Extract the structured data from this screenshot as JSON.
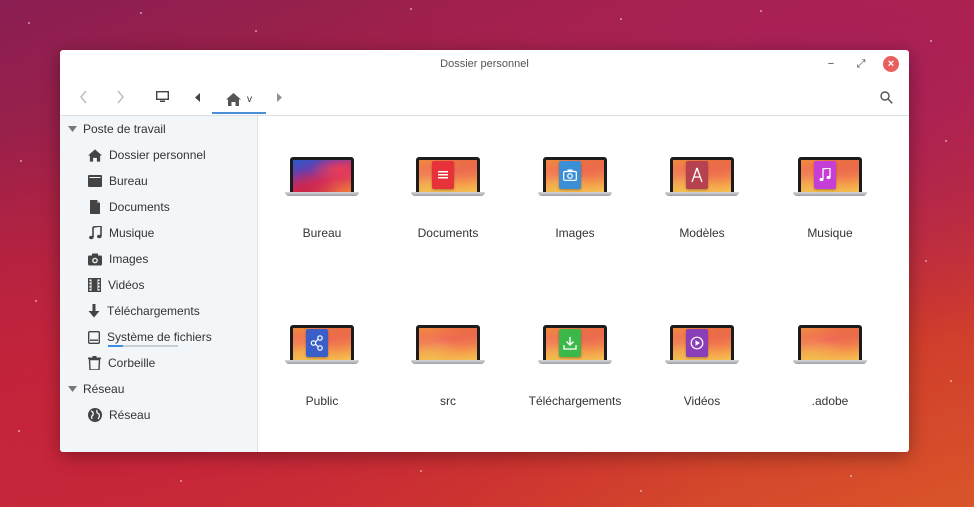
{
  "window": {
    "title": "Dossier personnel",
    "close_glyph": "×",
    "minimize_glyph": "−",
    "maximize_glyph": "⤢"
  },
  "toolbar": {
    "back_icon": "chevron-left-icon",
    "forward_icon": "chevron-right-icon",
    "computer_icon": "monitor-icon",
    "home_crumb_suffix": "v",
    "search_icon": "search-icon"
  },
  "sidebar": {
    "sections": [
      {
        "label": "Poste de travail"
      },
      {
        "label": "Réseau"
      }
    ],
    "items": [
      {
        "label": "Dossier personnel",
        "icon": "home-icon"
      },
      {
        "label": "Bureau",
        "icon": "desktop-icon"
      },
      {
        "label": "Documents",
        "icon": "document-icon"
      },
      {
        "label": "Musique",
        "icon": "music-icon"
      },
      {
        "label": "Images",
        "icon": "camera-icon"
      },
      {
        "label": "Vidéos",
        "icon": "film-icon"
      },
      {
        "label": "Téléchargements",
        "icon": "download-icon"
      },
      {
        "label": "Système de fichiers",
        "icon": "drive-icon"
      },
      {
        "label": "Corbeille",
        "icon": "trash-icon"
      },
      {
        "label": "Réseau",
        "icon": "globe-icon"
      }
    ],
    "filesystem_usage": 0.21
  },
  "folders": [
    {
      "label": "Bureau",
      "badge": "none"
    },
    {
      "label": "Documents",
      "badge": "document-icon",
      "color": "#e8323a"
    },
    {
      "label": "Images",
      "badge": "camera-icon",
      "color": "#3a8fd6"
    },
    {
      "label": "Modèles",
      "badge": "template-icon",
      "color": "#b5424e"
    },
    {
      "label": "Musique",
      "badge": "music-icon",
      "color": "#c53fd6"
    },
    {
      "label": "Public",
      "badge": "share-icon",
      "color": "#3b5fc9"
    },
    {
      "label": "src",
      "badge": "none"
    },
    {
      "label": "Téléchargements",
      "badge": "download-icon",
      "color": "#3cb84a"
    },
    {
      "label": "Vidéos",
      "badge": "play-icon",
      "color": "#8a3fb8"
    },
    {
      "label": ".adobe",
      "badge": "none"
    }
  ],
  "colors": {
    "accent": "#4a90d9",
    "close_button": "#e95f5f",
    "sidebar_bg": "#f3f6f9"
  }
}
